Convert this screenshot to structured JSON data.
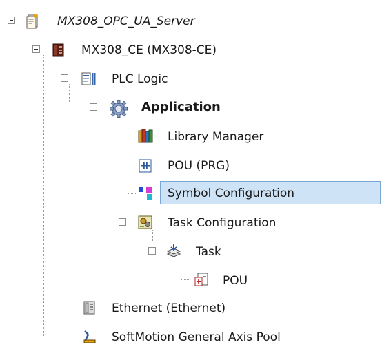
{
  "tree": {
    "items": [
      {
        "label": "MX308_OPC_UA_Server",
        "icon": "project-icon"
      },
      {
        "label": "MX308_CE (MX308-CE)",
        "icon": "device-icon"
      },
      {
        "label": "PLC Logic",
        "icon": "plc-logic-icon"
      },
      {
        "label": "Application",
        "icon": "application-gear-icon"
      },
      {
        "label": "Library Manager",
        "icon": "library-manager-icon"
      },
      {
        "label": "POU (PRG)",
        "icon": "pou-prg-icon"
      },
      {
        "label": "Symbol Configuration",
        "icon": "symbol-configuration-icon"
      },
      {
        "label": "Task Configuration",
        "icon": "task-configuration-icon"
      },
      {
        "label": "Task",
        "icon": "task-icon"
      },
      {
        "label": "POU",
        "icon": "pou-icon"
      },
      {
        "label": "Ethernet (Ethernet)",
        "icon": "ethernet-icon"
      },
      {
        "label": "SoftMotion General Axis Pool",
        "icon": "axis-pool-icon"
      }
    ],
    "selected": "Symbol Configuration",
    "colors": {
      "selection_bg": "#cfe3f7",
      "selection_border": "#7aa7d6"
    }
  }
}
